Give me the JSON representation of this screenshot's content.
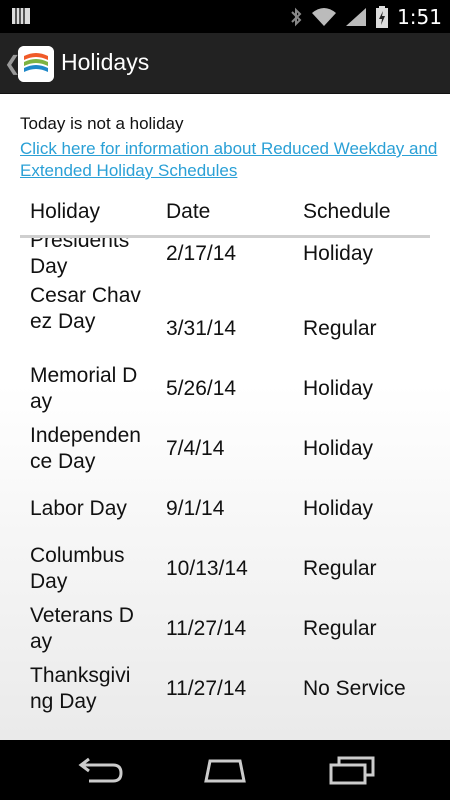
{
  "status_bar": {
    "time": "1:51"
  },
  "action_bar": {
    "title": "Holidays"
  },
  "content": {
    "today_text": "Today is not a holiday",
    "info_link": "Click here for information about Reduced Weekday and Extended Holiday Schedules",
    "columns": [
      "Holiday",
      "Date",
      "Schedule"
    ],
    "rows": [
      {
        "name": "Presidents Day",
        "date": "2/17/14",
        "schedule": "Holiday"
      },
      {
        "name": "Cesar Chavez Day",
        "date": "3/31/14",
        "schedule": "Regular"
      },
      {
        "name": "Memorial Day",
        "date": "5/26/14",
        "schedule": "Holiday"
      },
      {
        "name": "Independence Day",
        "date": "7/4/14",
        "schedule": "Holiday"
      },
      {
        "name": "Labor Day",
        "date": "9/1/14",
        "schedule": "Holiday"
      },
      {
        "name": "Columbus Day",
        "date": "10/13/14",
        "schedule": "Regular"
      },
      {
        "name": "Veterans Day",
        "date": "11/27/14",
        "schedule": "Regular"
      },
      {
        "name": "Thanksgiving Day",
        "date": "11/27/14",
        "schedule": "No Service"
      }
    ]
  },
  "icons": {
    "notification": "sim-notification-icon",
    "bluetooth": "bluetooth-icon",
    "wifi": "wifi-icon",
    "signal": "signal-icon",
    "battery": "battery-charging-icon",
    "up": "chevron-left-icon",
    "app": "app-logo-icon",
    "back": "back-icon",
    "home": "home-icon",
    "recents": "recent-apps-icon"
  },
  "colors": {
    "link": "#2aa0d6",
    "actionbar": "#222222",
    "divider": "#cfcfcf"
  }
}
